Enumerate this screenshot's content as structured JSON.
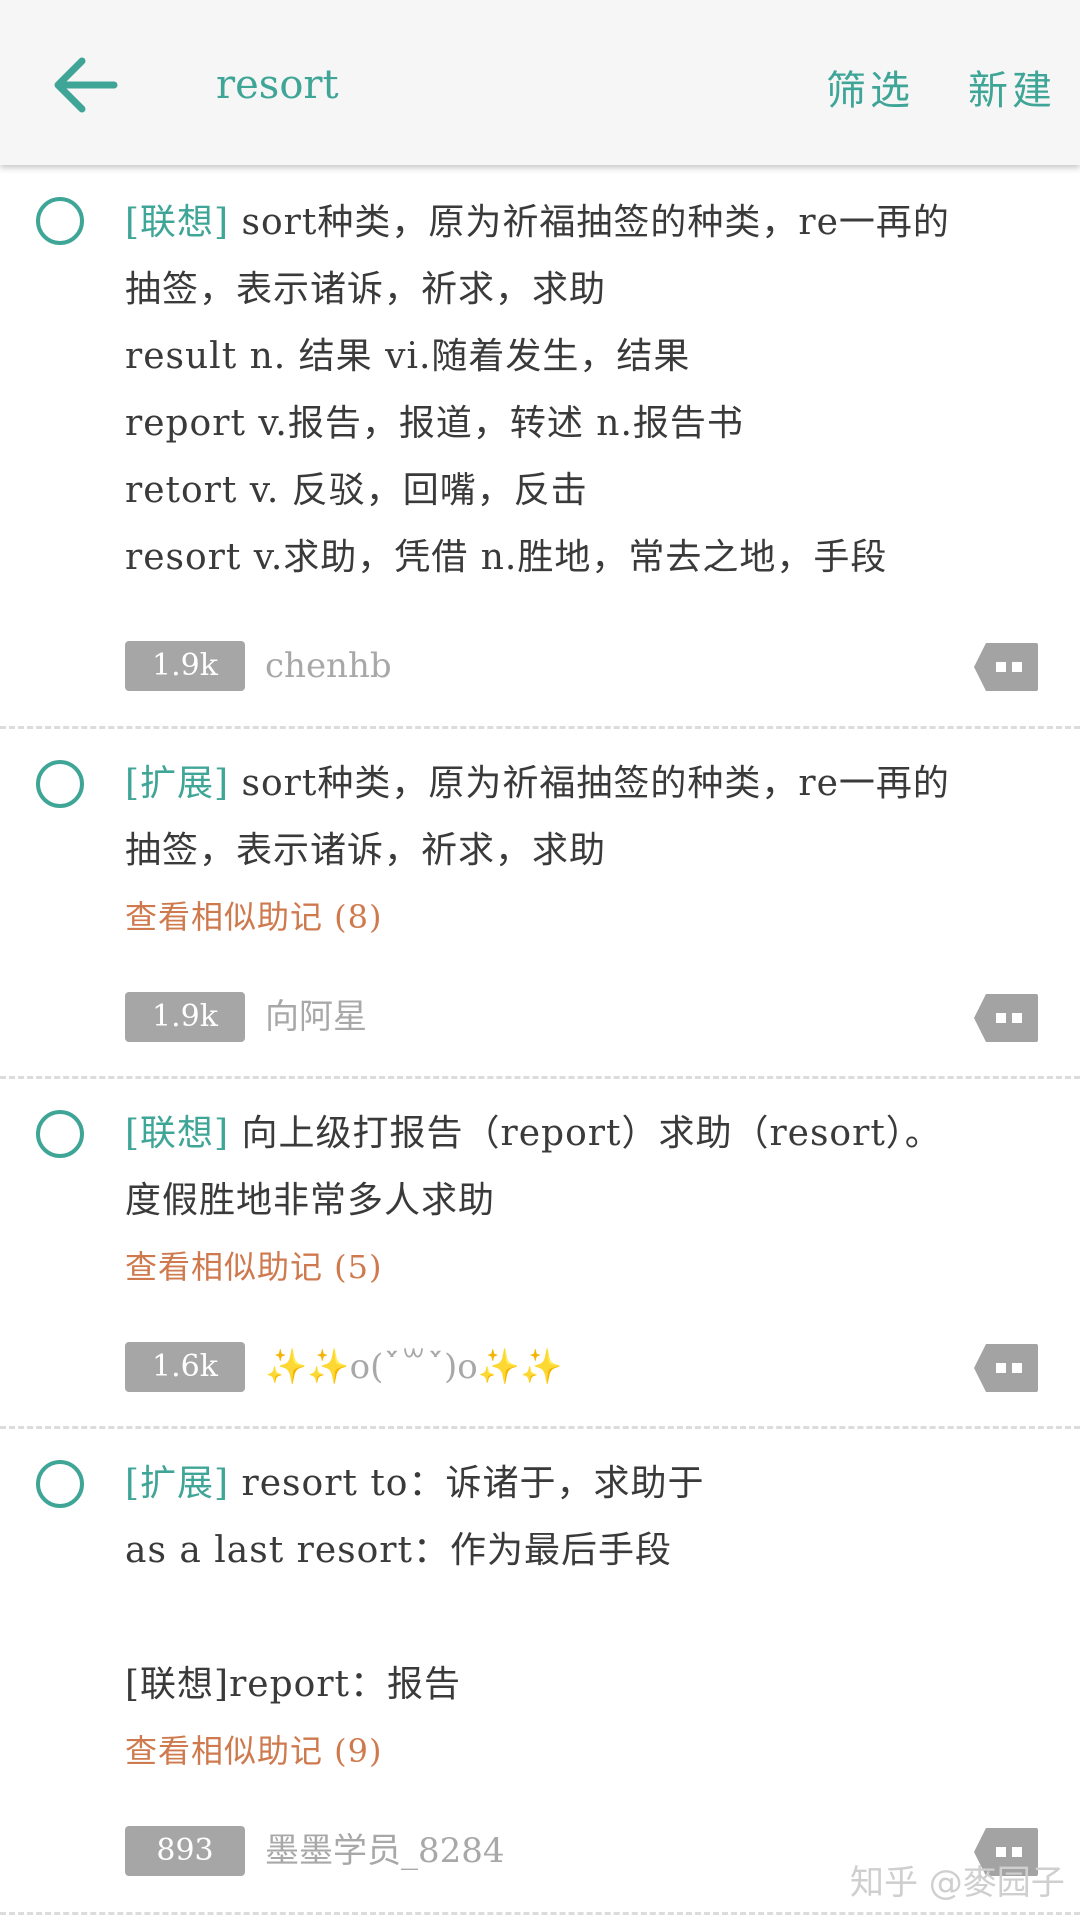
{
  "header": {
    "title": "resort",
    "filter_label": "筛选",
    "new_label": "新建"
  },
  "entries": [
    {
      "tag": "[联想]",
      "first_line": " sort种类，原为祈福抽签的种类，re一再的",
      "lines": [
        "抽签，表示诸诉，祈求，求助",
        "result n. 结果 vi.随着发生，结果",
        "report v.报告，报道，转述 n.报告书",
        "retort v. 反驳，回嘴，反击",
        "resort v.求助，凭借 n.胜地，常去之地，手段"
      ],
      "similar": "",
      "count": "1.9k",
      "author": "chenhb"
    },
    {
      "tag": "[扩展]",
      "first_line": " sort种类，原为祈福抽签的种类，re一再的",
      "lines": [
        "抽签，表示诸诉，祈求，求助"
      ],
      "similar": "查看相似助记 (8)",
      "count": "1.9k",
      "author": "向阿星"
    },
    {
      "tag": "[联想]",
      "first_line": " 向上级打报告（report）求助（resort）。",
      "lines": [
        "度假胜地非常多人求助"
      ],
      "similar": "查看相似助记 (5)",
      "count": "1.6k",
      "author": "✨✨ο(ˊ̀꒳ˋ́)ο✨✨"
    },
    {
      "tag": "[扩展]",
      "first_line": " resort to：诉诸于，求助于",
      "lines": [
        "as a last resort：作为最后手段",
        "",
        "[联想]report：报告"
      ],
      "similar": "查看相似助记 (9)",
      "count": "893",
      "author": "墨墨学员_8284"
    }
  ],
  "watermark": "知乎 @麥园子",
  "colors": {
    "accent": "#3fa597",
    "similar_link": "#cf7a4e",
    "badge": "#a6a6a6",
    "icon_gray": "#a3a3a3"
  },
  "icons": [
    "arrow-left-icon",
    "radio-circle-icon",
    "comment-icon"
  ]
}
